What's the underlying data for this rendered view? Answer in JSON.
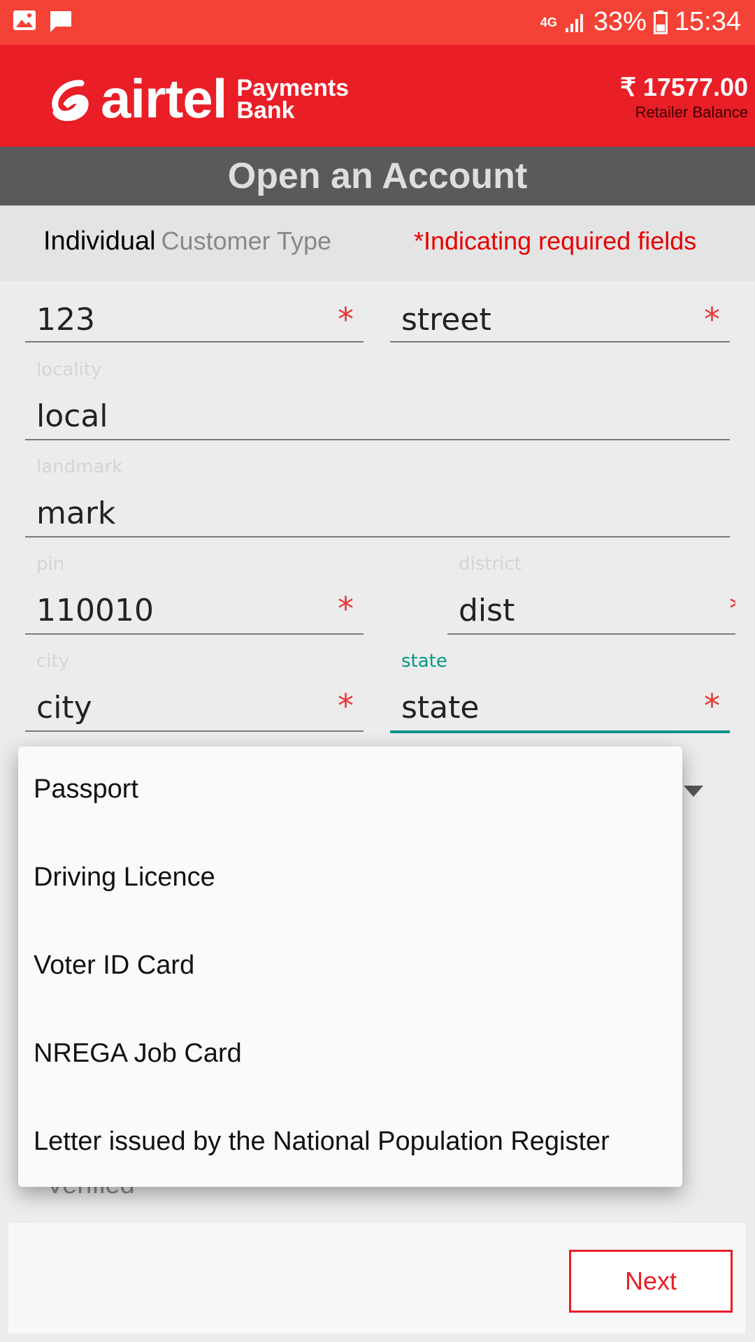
{
  "status_bar": {
    "network": "4G",
    "battery": "33%",
    "time": "15:34",
    "icons": [
      "gallery-icon",
      "message-icon",
      "signal-icon",
      "battery-icon"
    ]
  },
  "header": {
    "brand": "airtel",
    "brand_sub_line1": "Payments",
    "brand_sub_line2": "Bank",
    "balance_amount": "₹ 17577.00",
    "balance_label": "Retailer Balance"
  },
  "title": "Open an Account",
  "info": {
    "customer_type_value": "Individual",
    "customer_type_label": "Customer Type",
    "required_note": "*Indicating required fields"
  },
  "form": {
    "house_no": {
      "value": "123",
      "required": "*"
    },
    "street": {
      "value": "street",
      "required": "*"
    },
    "locality": {
      "label": "locality",
      "value": "local"
    },
    "landmark": {
      "label": "landmark",
      "value": "mark"
    },
    "pin": {
      "label": "pin",
      "value": "110010",
      "required": "*"
    },
    "district": {
      "label": "district",
      "value": "dist",
      "required": "*"
    },
    "city": {
      "label": "city",
      "value": "city",
      "required": "*"
    },
    "state": {
      "label": "state",
      "value": "state",
      "required": "*"
    },
    "verified_text": "Verified"
  },
  "dropdown": {
    "options": [
      "Passport",
      "Driving Licence",
      "Voter ID Card",
      "NREGA Job Card",
      "Letter issued by the National Population Register"
    ]
  },
  "footer": {
    "next_label": "Next"
  },
  "colors": {
    "status_bar": "#f44336",
    "brand_red": "#e91e26",
    "title_bar": "#5a5a5a",
    "focus_teal": "#009688",
    "required_red": "#e53935"
  }
}
